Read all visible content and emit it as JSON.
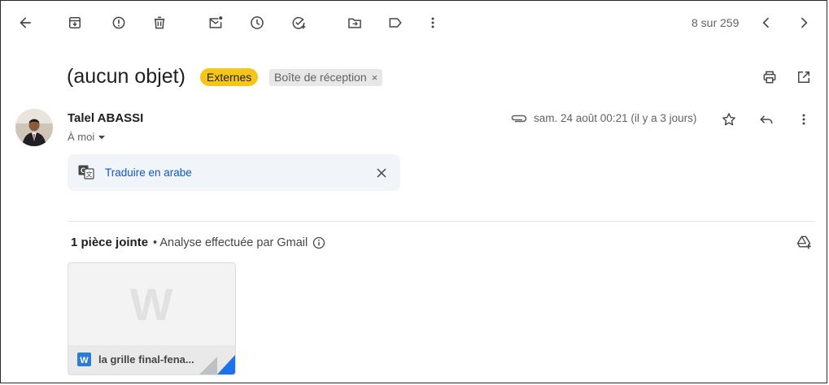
{
  "toolbar": {
    "pagination": "8 sur 259"
  },
  "message": {
    "subject": "(aucun objet)",
    "labels": {
      "external": "Externes",
      "inbox": "Boîte de réception",
      "inbox_remove": "×"
    },
    "sender": "Talel ABASSI",
    "to": "À moi",
    "date": "sam. 24 août 00:21 (il y a 3 jours)"
  },
  "translate": {
    "link": "Traduire en arabe"
  },
  "attachments": {
    "count_label": "1 pièce jointe",
    "scan_text": "• Analyse effectuée par Gmail",
    "items": [
      {
        "name": "la grille final-fena...",
        "type_letter": "W"
      }
    ]
  },
  "icons": [
    "arrow-back-icon",
    "archive-icon",
    "report-spam-icon",
    "delete-icon",
    "mark-unread-icon",
    "snooze-icon",
    "add-task-icon",
    "move-to-icon",
    "label-icon",
    "more-vert-icon",
    "chevron-left-icon",
    "chevron-right-icon",
    "print-icon",
    "open-new-window-icon",
    "attachment-clip-icon",
    "star-icon",
    "reply-icon",
    "translate-icon",
    "close-icon",
    "info-icon",
    "add-to-drive-icon",
    "word-file-icon"
  ],
  "colors": {
    "external_label": "#f5c518",
    "link": "#0b57d0",
    "word_blue": "#2b7cd3"
  }
}
